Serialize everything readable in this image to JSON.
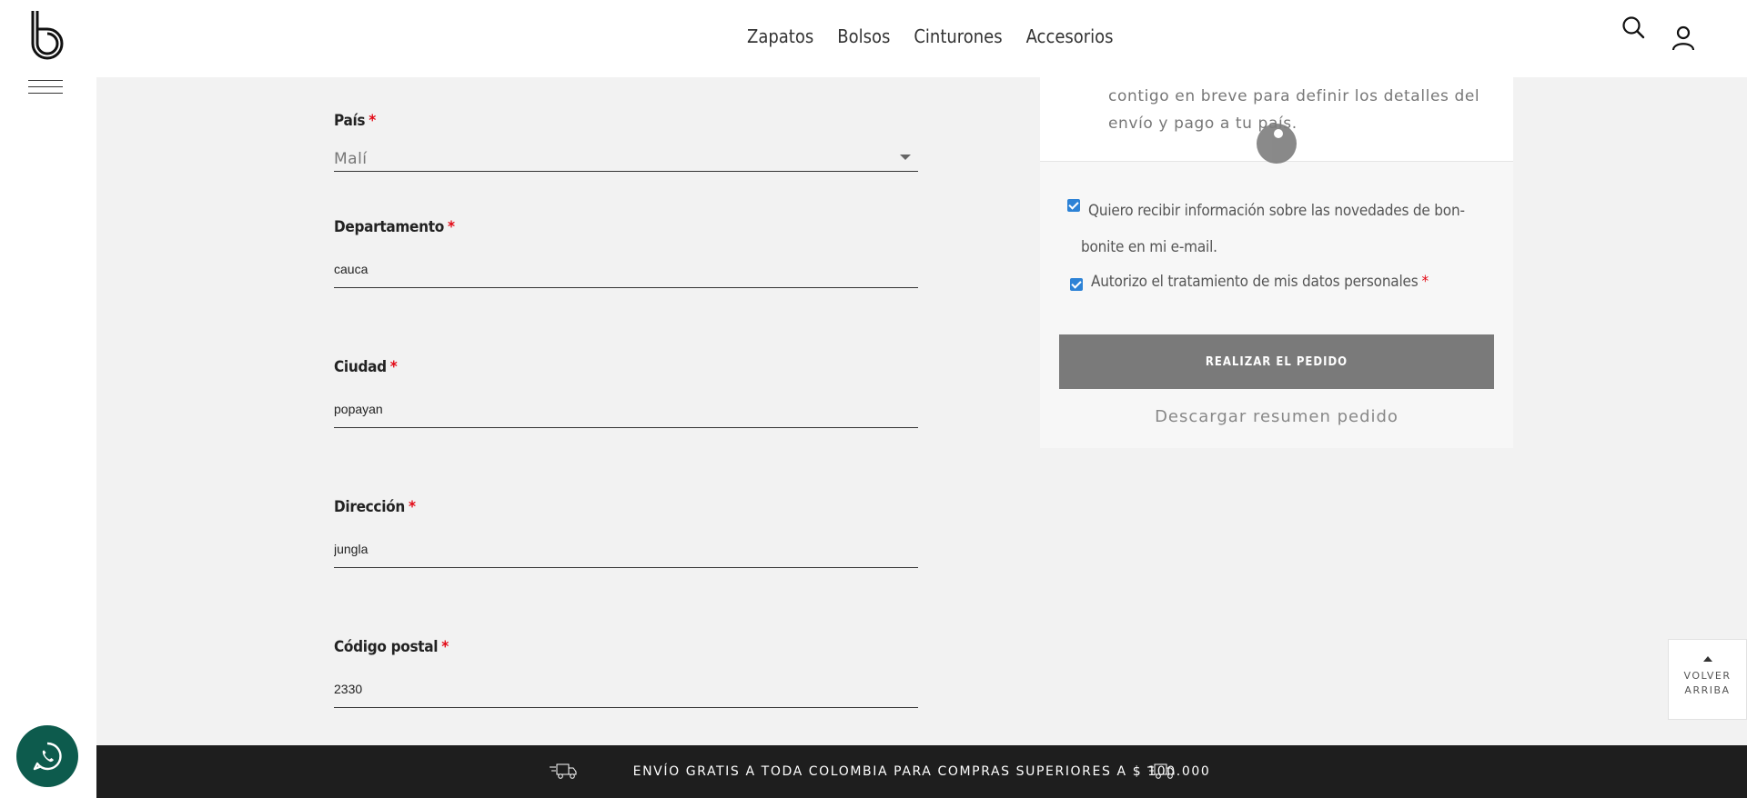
{
  "header": {
    "nav": [
      "Zapatos",
      "Bolsos",
      "Cinturones",
      "Accesorios"
    ],
    "icons": [
      "search-icon",
      "user-icon",
      "menu-icon"
    ]
  },
  "form": {
    "pais": {
      "label": "País",
      "required_mark": "*",
      "value": "Malí"
    },
    "departamento": {
      "label": "Departamento",
      "required_mark": "*",
      "value": "cauca"
    },
    "ciudad": {
      "label": "Ciudad",
      "required_mark": "*",
      "value": "popayan"
    },
    "direccion": {
      "label": "Dirección",
      "required_mark": "*",
      "value": "jungla"
    },
    "codigo_postal": {
      "label": "Código postal",
      "required_mark": "*",
      "value": "2330"
    }
  },
  "summary": {
    "notice_text": "contigo en breve para definir los detalles del envío y pago a tu país.",
    "newsletter_label": "Quiero recibir información sobre las novedades de bon-bonite en mi e-mail.",
    "newsletter_checked": true,
    "privacy_label": "Autorizo el tratamiento de mis datos personales",
    "privacy_required_mark": "*",
    "privacy_checked": true,
    "order_button": "REALIZAR EL PEDIDO",
    "download_link": "Descargar resumen pedido"
  },
  "back_to_top": {
    "line1": "VOLVER",
    "line2": "ARRIBA"
  },
  "shipping_banner": "ENVÍO GRATIS A TODA COLOMBIA PARA COMPRAS SUPERIORES A $ 100.000",
  "colors": {
    "accent_required": "#e30613",
    "checkbox": "#2c82d6",
    "button": "#7a7a7a",
    "whatsapp": "#0d5b4d",
    "footer": "#1e1e1e"
  }
}
